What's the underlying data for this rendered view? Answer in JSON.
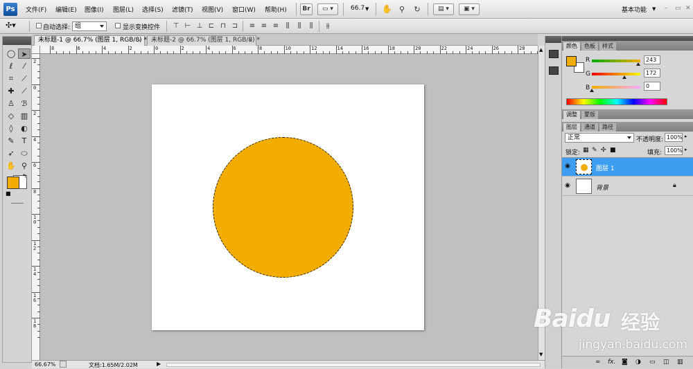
{
  "app": {
    "logo": "Ps",
    "menus": [
      "文件(F)",
      "编辑(E)",
      "图像(I)",
      "图层(L)",
      "选择(S)",
      "滤镜(T)",
      "视图(V)",
      "窗口(W)",
      "帮助(H)"
    ],
    "bridge_label": "Br",
    "zoom_value": "66.7",
    "workspace": "基本功能",
    "window_controls": [
      "–",
      "▭",
      "✕"
    ]
  },
  "options": {
    "auto_select_label": "自动选择:",
    "auto_select_value": "组",
    "show_transform_label": "显示变换控件"
  },
  "tabs": [
    {
      "label": "未标题-1 @ 66.7% (图层 1, RGB/8) *",
      "close": "×"
    },
    {
      "label": "未标题-2 @ 66.7% (图层 1, RGB/8) *",
      "close": "×"
    }
  ],
  "ruler": {
    "top": [
      "8",
      "6",
      "4",
      "2",
      "0",
      "2",
      "4",
      "6",
      "8",
      "10",
      "12",
      "14",
      "16",
      "18",
      "20",
      "22",
      "24",
      "26",
      "28"
    ],
    "left": [
      "2",
      "0",
      "2",
      "4",
      "6",
      "8",
      "1 0",
      "1 2",
      "1 4",
      "1 6",
      "1 8"
    ]
  },
  "canvas": {
    "shape_color": "#f3ac00",
    "foreground_color": "#f3ac00",
    "background_color": "#ffffff"
  },
  "status": {
    "zoom": "66.67%",
    "doc_info": "文档:1.65M/2.02M"
  },
  "color_panel": {
    "tabs": [
      "颜色",
      "色板",
      "样式"
    ],
    "channels": [
      {
        "label": "R",
        "value": "243",
        "level": 0.95
      },
      {
        "label": "G",
        "value": "172",
        "level": 0.67
      },
      {
        "label": "B",
        "value": "0",
        "level": 0.0
      }
    ]
  },
  "adjust_panel": {
    "tabs": [
      "调整",
      "蒙版"
    ]
  },
  "layers_panel": {
    "tabs": [
      "图层",
      "通道",
      "路径"
    ],
    "blend_mode": "正常",
    "opacity_label": "不透明度:",
    "opacity_value": "100%",
    "lock_label": "锁定:",
    "fill_label": "填充:",
    "fill_value": "100%",
    "layers": [
      {
        "name": "图层 1",
        "selected": true
      },
      {
        "name": "背景",
        "selected": false
      }
    ],
    "footer_icons": [
      "link-icon",
      "fx-icon",
      "mask-icon",
      "adjustment-icon",
      "folder-icon",
      "new-layer-icon",
      "trash-icon"
    ]
  },
  "watermark": {
    "brand": "Baidu",
    "brand_cn": "经验",
    "url": "jingyan.baidu.com"
  }
}
